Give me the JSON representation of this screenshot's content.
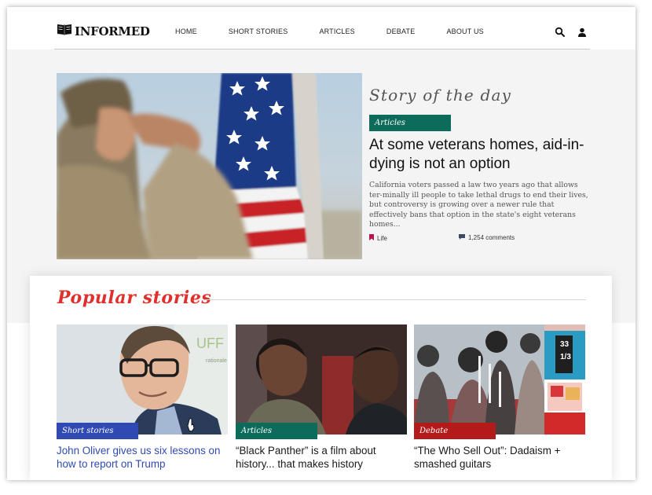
{
  "site": {
    "logo_text": "INFORMED"
  },
  "nav": {
    "items": [
      {
        "label": "HOME"
      },
      {
        "label": "SHORT STORIES"
      },
      {
        "label": "ARTICLES"
      },
      {
        "label": "DEBATE"
      },
      {
        "label": "ABOUT US"
      }
    ]
  },
  "header": {
    "icons": [
      "search-icon",
      "user-icon"
    ]
  },
  "story_of_day": {
    "heading": "Story of the day",
    "tag": "Articles",
    "title": "At some veterans homes, aid-in-dying is not an option",
    "excerpt": "California voters passed a law two years ago that allows ter-minally ill people to take lethal drugs to end their lives, but controversy is growing over a newer rule that effectively bans that option in the state's eight veterans homes...",
    "category": "Life",
    "comments": "1,254 comments"
  },
  "popular": {
    "heading": "Popular stories",
    "stories": [
      {
        "tag": "Short stories",
        "title": "John Oliver gives us six lessons on how to report on Trump"
      },
      {
        "tag": "Articles",
        "title": "“Black Panther” is a film about history... that makes history"
      },
      {
        "tag": "Debate",
        "title": "“The Who Sell Out”: Dadaism + smashed guitars"
      }
    ]
  },
  "colors": {
    "articles": "#0c6b5a",
    "short_stories": "#2f4bb3",
    "debate": "#b31b1b",
    "popular_heading": "#e0302b"
  }
}
